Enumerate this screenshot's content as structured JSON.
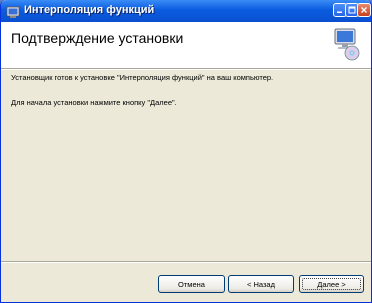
{
  "window": {
    "title": "Интерполяция функций"
  },
  "header": {
    "title": "Подтверждение установки",
    "icon": "computer-install-icon"
  },
  "body": {
    "line1": "Установщик готов к установке \"Интерполяция функций\" на ваш компьютер.",
    "line2": "Для начала установки нажмите кнопку \"Далее\"."
  },
  "buttons": {
    "cancel": "Отмена",
    "back": "< Назад",
    "next": "Далее >"
  },
  "colors": {
    "titlebar": "#0b5ce0",
    "dialog_bg": "#ece9d8",
    "button_border": "#003c74"
  }
}
